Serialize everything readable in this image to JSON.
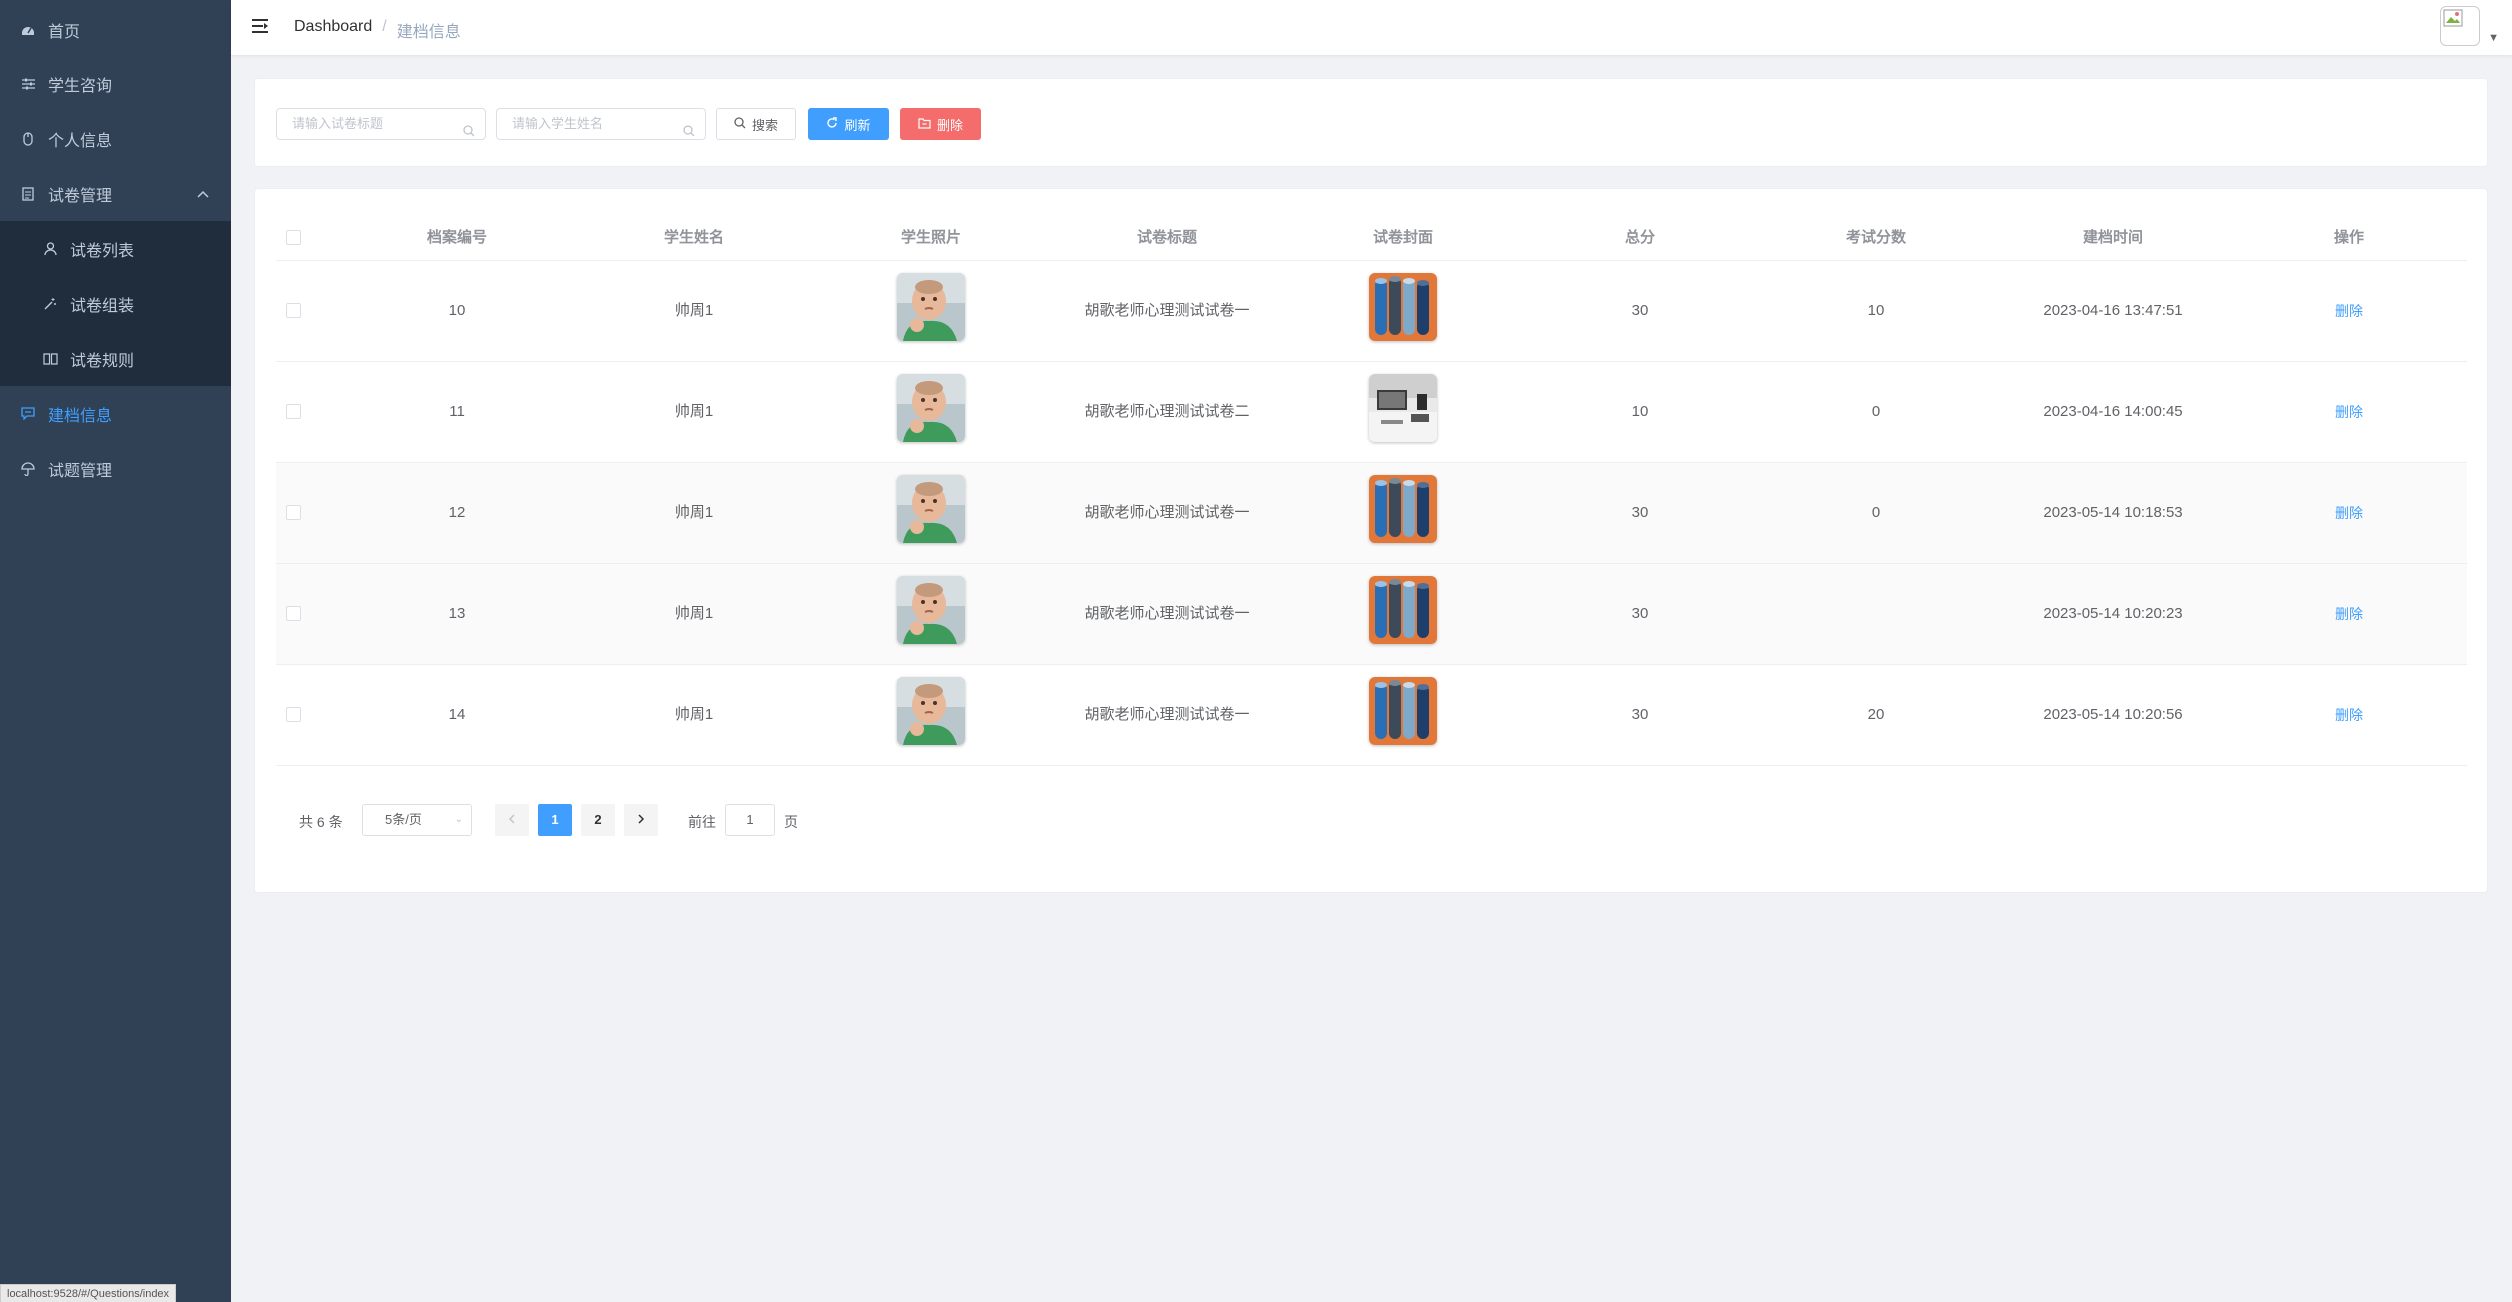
{
  "sidebar": {
    "items": [
      {
        "label": "首页",
        "icon": "dashboard-icon"
      },
      {
        "label": "学生咨询",
        "icon": "sliders-icon"
      },
      {
        "label": "个人信息",
        "icon": "mouse-icon"
      },
      {
        "label": "试卷管理",
        "icon": "document-icon",
        "expanded": true
      },
      {
        "label": "试卷列表",
        "icon": "user-icon"
      },
      {
        "label": "试卷组装",
        "icon": "magic-icon"
      },
      {
        "label": "试卷规则",
        "icon": "book-icon"
      },
      {
        "label": "建档信息",
        "icon": "chat-icon",
        "active": true
      },
      {
        "label": "试题管理",
        "icon": "umbrella-icon"
      }
    ],
    "status_url": "localhost:9528/#/Questions/index"
  },
  "navbar": {
    "breadcrumb_home": "Dashboard",
    "breadcrumb_sep": "/",
    "breadcrumb_current": "建档信息"
  },
  "filters": {
    "title_placeholder": "请输入试卷标题",
    "name_placeholder": "请输入学生姓名",
    "search_label": "搜索",
    "refresh_label": "刷新",
    "delete_label": "删除"
  },
  "table": {
    "headers": [
      "档案编号",
      "学生姓名",
      "学生照片",
      "试卷标题",
      "试卷封面",
      "总分",
      "考试分数",
      "建档时间",
      "操作"
    ],
    "rows": [
      {
        "id": "10",
        "name": "帅周1",
        "title": "胡歌老师心理测试试卷一",
        "cover": "yoga-mats",
        "total": "30",
        "score": "10",
        "time": "2023-04-16 13:47:51",
        "action": "删除"
      },
      {
        "id": "11",
        "name": "帅周1",
        "title": "胡歌老师心理测试试卷二",
        "cover": "desk-office",
        "total": "10",
        "score": "0",
        "time": "2023-04-16 14:00:45",
        "action": "删除"
      },
      {
        "id": "12",
        "name": "帅周1",
        "title": "胡歌老师心理测试试卷一",
        "cover": "yoga-mats",
        "total": "30",
        "score": "0",
        "time": "2023-05-14 10:18:53",
        "action": "删除"
      },
      {
        "id": "13",
        "name": "帅周1",
        "title": "胡歌老师心理测试试卷一",
        "cover": "yoga-mats",
        "total": "30",
        "score": "",
        "time": "2023-05-14 10:20:23",
        "action": "删除"
      },
      {
        "id": "14",
        "name": "帅周1",
        "title": "胡歌老师心理测试试卷一",
        "cover": "yoga-mats",
        "total": "30",
        "score": "20",
        "time": "2023-05-14 10:20:56",
        "action": "删除"
      }
    ]
  },
  "pagination": {
    "total_text": "共 6 条",
    "page_size": "5条/页",
    "pages": [
      "1",
      "2"
    ],
    "current_page": "1",
    "goto_label": "前往",
    "jump_value": "1",
    "unit": "页"
  },
  "colors": {
    "sidebar_bg": "#304156",
    "primary": "#409eff",
    "danger": "#f56c6c"
  }
}
